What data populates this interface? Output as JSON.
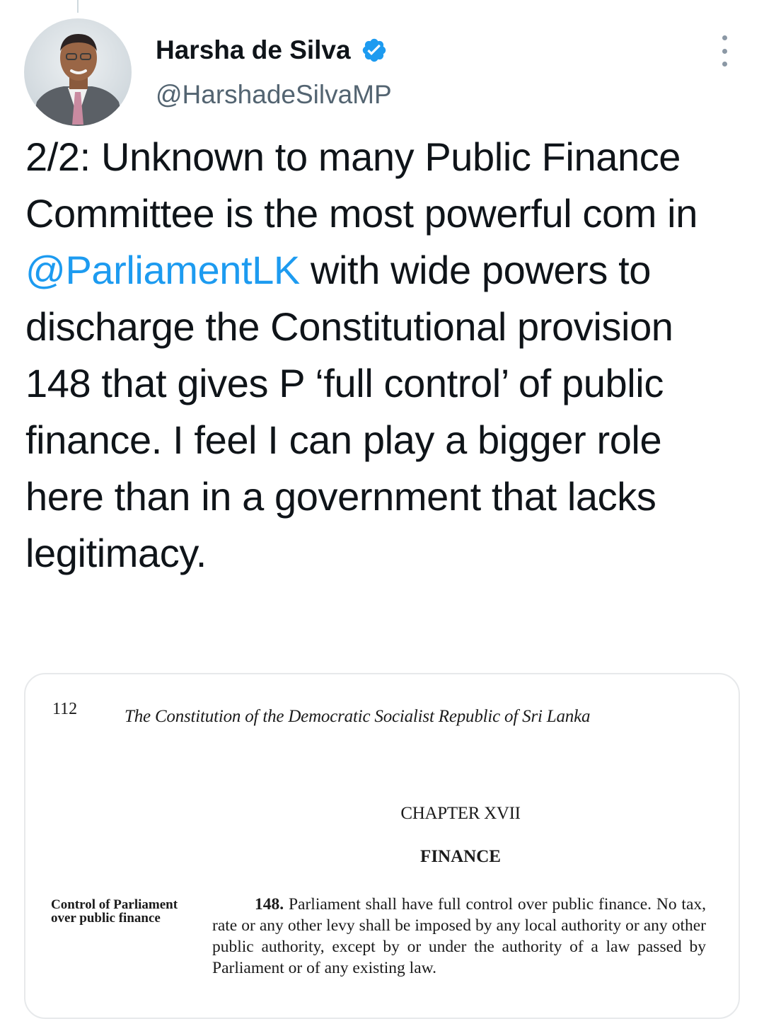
{
  "author": {
    "display_name": "Harsha de Silva",
    "handle": "@HarshadeSilvaMP",
    "verified": true,
    "avatar_icon": "profile-photo"
  },
  "tweet": {
    "text_before_mention": "2/2: Unknown to many Public Finance Committee is the most powerful com in ",
    "mention": "@ParliamentLK",
    "text_after_mention": " with wide powers to discharge the Constitutional provision 148 that gives P ‘full control’ of public finance. I feel I can play a bigger role here than in a government that lacks legitimacy."
  },
  "media": {
    "page_number": "112",
    "header": "The Constitution of the Democratic Socialist Republic of Sri Lanka",
    "chapter": "CHAPTER XVII",
    "section_title": "FINANCE",
    "margin_note": "Control of Parliament over public finance",
    "section_number": "148.",
    "section_text": "Parliament shall have full control over public finance. No tax, rate or any other levy shall be imposed by any local authority or any other public authority, except by or under the authority of a law passed by Parliament or of any existing law."
  },
  "colors": {
    "link": "#1d9bf0",
    "verified_badge": "#1d9bf0",
    "secondary_text": "#536471",
    "text": "#0f1419"
  },
  "icons": {
    "verified": "verified-badge-icon",
    "more": "more-options-icon"
  }
}
